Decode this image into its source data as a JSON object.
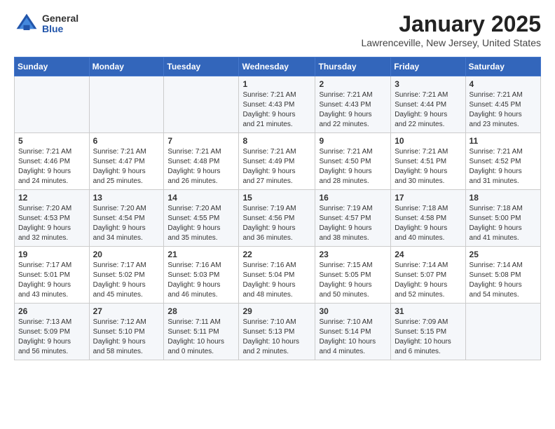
{
  "logo": {
    "general": "General",
    "blue": "Blue"
  },
  "header": {
    "month": "January 2025",
    "location": "Lawrenceville, New Jersey, United States"
  },
  "weekdays": [
    "Sunday",
    "Monday",
    "Tuesday",
    "Wednesday",
    "Thursday",
    "Friday",
    "Saturday"
  ],
  "weeks": [
    [
      {
        "day": "",
        "info": ""
      },
      {
        "day": "",
        "info": ""
      },
      {
        "day": "",
        "info": ""
      },
      {
        "day": "1",
        "info": "Sunrise: 7:21 AM\nSunset: 4:43 PM\nDaylight: 9 hours\nand 21 minutes."
      },
      {
        "day": "2",
        "info": "Sunrise: 7:21 AM\nSunset: 4:43 PM\nDaylight: 9 hours\nand 22 minutes."
      },
      {
        "day": "3",
        "info": "Sunrise: 7:21 AM\nSunset: 4:44 PM\nDaylight: 9 hours\nand 22 minutes."
      },
      {
        "day": "4",
        "info": "Sunrise: 7:21 AM\nSunset: 4:45 PM\nDaylight: 9 hours\nand 23 minutes."
      }
    ],
    [
      {
        "day": "5",
        "info": "Sunrise: 7:21 AM\nSunset: 4:46 PM\nDaylight: 9 hours\nand 24 minutes."
      },
      {
        "day": "6",
        "info": "Sunrise: 7:21 AM\nSunset: 4:47 PM\nDaylight: 9 hours\nand 25 minutes."
      },
      {
        "day": "7",
        "info": "Sunrise: 7:21 AM\nSunset: 4:48 PM\nDaylight: 9 hours\nand 26 minutes."
      },
      {
        "day": "8",
        "info": "Sunrise: 7:21 AM\nSunset: 4:49 PM\nDaylight: 9 hours\nand 27 minutes."
      },
      {
        "day": "9",
        "info": "Sunrise: 7:21 AM\nSunset: 4:50 PM\nDaylight: 9 hours\nand 28 minutes."
      },
      {
        "day": "10",
        "info": "Sunrise: 7:21 AM\nSunset: 4:51 PM\nDaylight: 9 hours\nand 30 minutes."
      },
      {
        "day": "11",
        "info": "Sunrise: 7:21 AM\nSunset: 4:52 PM\nDaylight: 9 hours\nand 31 minutes."
      }
    ],
    [
      {
        "day": "12",
        "info": "Sunrise: 7:20 AM\nSunset: 4:53 PM\nDaylight: 9 hours\nand 32 minutes."
      },
      {
        "day": "13",
        "info": "Sunrise: 7:20 AM\nSunset: 4:54 PM\nDaylight: 9 hours\nand 34 minutes."
      },
      {
        "day": "14",
        "info": "Sunrise: 7:20 AM\nSunset: 4:55 PM\nDaylight: 9 hours\nand 35 minutes."
      },
      {
        "day": "15",
        "info": "Sunrise: 7:19 AM\nSunset: 4:56 PM\nDaylight: 9 hours\nand 36 minutes."
      },
      {
        "day": "16",
        "info": "Sunrise: 7:19 AM\nSunset: 4:57 PM\nDaylight: 9 hours\nand 38 minutes."
      },
      {
        "day": "17",
        "info": "Sunrise: 7:18 AM\nSunset: 4:58 PM\nDaylight: 9 hours\nand 40 minutes."
      },
      {
        "day": "18",
        "info": "Sunrise: 7:18 AM\nSunset: 5:00 PM\nDaylight: 9 hours\nand 41 minutes."
      }
    ],
    [
      {
        "day": "19",
        "info": "Sunrise: 7:17 AM\nSunset: 5:01 PM\nDaylight: 9 hours\nand 43 minutes."
      },
      {
        "day": "20",
        "info": "Sunrise: 7:17 AM\nSunset: 5:02 PM\nDaylight: 9 hours\nand 45 minutes."
      },
      {
        "day": "21",
        "info": "Sunrise: 7:16 AM\nSunset: 5:03 PM\nDaylight: 9 hours\nand 46 minutes."
      },
      {
        "day": "22",
        "info": "Sunrise: 7:16 AM\nSunset: 5:04 PM\nDaylight: 9 hours\nand 48 minutes."
      },
      {
        "day": "23",
        "info": "Sunrise: 7:15 AM\nSunset: 5:05 PM\nDaylight: 9 hours\nand 50 minutes."
      },
      {
        "day": "24",
        "info": "Sunrise: 7:14 AM\nSunset: 5:07 PM\nDaylight: 9 hours\nand 52 minutes."
      },
      {
        "day": "25",
        "info": "Sunrise: 7:14 AM\nSunset: 5:08 PM\nDaylight: 9 hours\nand 54 minutes."
      }
    ],
    [
      {
        "day": "26",
        "info": "Sunrise: 7:13 AM\nSunset: 5:09 PM\nDaylight: 9 hours\nand 56 minutes."
      },
      {
        "day": "27",
        "info": "Sunrise: 7:12 AM\nSunset: 5:10 PM\nDaylight: 9 hours\nand 58 minutes."
      },
      {
        "day": "28",
        "info": "Sunrise: 7:11 AM\nSunset: 5:11 PM\nDaylight: 10 hours\nand 0 minutes."
      },
      {
        "day": "29",
        "info": "Sunrise: 7:10 AM\nSunset: 5:13 PM\nDaylight: 10 hours\nand 2 minutes."
      },
      {
        "day": "30",
        "info": "Sunrise: 7:10 AM\nSunset: 5:14 PM\nDaylight: 10 hours\nand 4 minutes."
      },
      {
        "day": "31",
        "info": "Sunrise: 7:09 AM\nSunset: 5:15 PM\nDaylight: 10 hours\nand 6 minutes."
      },
      {
        "day": "",
        "info": ""
      }
    ]
  ]
}
